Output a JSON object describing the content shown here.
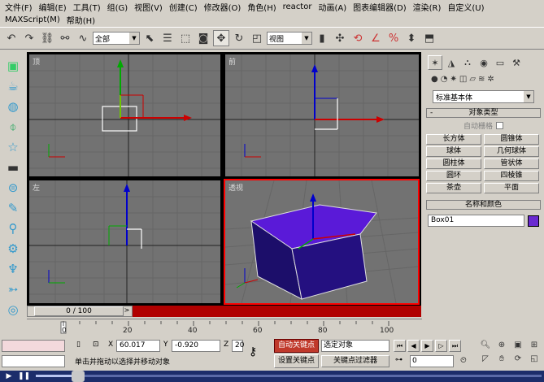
{
  "menu": {
    "row1": [
      "文件(F)",
      "编辑(E)",
      "工具(T)",
      "组(G)",
      "视图(V)",
      "创建(C)",
      "修改器(O)",
      "角色(H)",
      "reactor",
      "动画(A)",
      "图表编辑器(D)",
      "渲染(R)",
      "自定义(U)"
    ],
    "row2": [
      "MAXScript(M)",
      "帮助(H)"
    ]
  },
  "toolbar": {
    "selection_filter": "全部",
    "reference_coord": "视图"
  },
  "viewports": {
    "top_label": "顶",
    "front_label": "前",
    "left_label": "左",
    "persp_label": "透视"
  },
  "command_panel": {
    "dropdown": "标准基本体",
    "object_type_title": "对象类型",
    "autogrid_label": "自动栅格",
    "objects": [
      "长方体",
      "圆锥体",
      "球体",
      "几何球体",
      "圆柱体",
      "管状体",
      "圆环",
      "四棱锥",
      "茶壶",
      "平面"
    ],
    "name_color_title": "名称和颜色",
    "object_name": "Box01",
    "object_color": "#6a2ad0"
  },
  "timeline": {
    "slider_text": "0 / 100",
    "ticks": [
      "0",
      "20",
      "40",
      "60",
      "80",
      "100"
    ]
  },
  "status": {
    "x_label": "X",
    "x_value": "60.017",
    "y_label": "Y",
    "y_value": "-0.920",
    "z_label": "Z",
    "z_value": "20",
    "prompt": "单击并拖动以选择并移动对象",
    "auto_key": "自动关键点",
    "set_key": "设置关键点",
    "selected_set": "选定对象",
    "key_filters": "关键点过滤器",
    "frame": "0"
  },
  "colors": {
    "box_top": "#5a1ad8",
    "box_side": "#1c0e6a",
    "active_border": "#ff0000",
    "viewport_bg": "#727272"
  }
}
